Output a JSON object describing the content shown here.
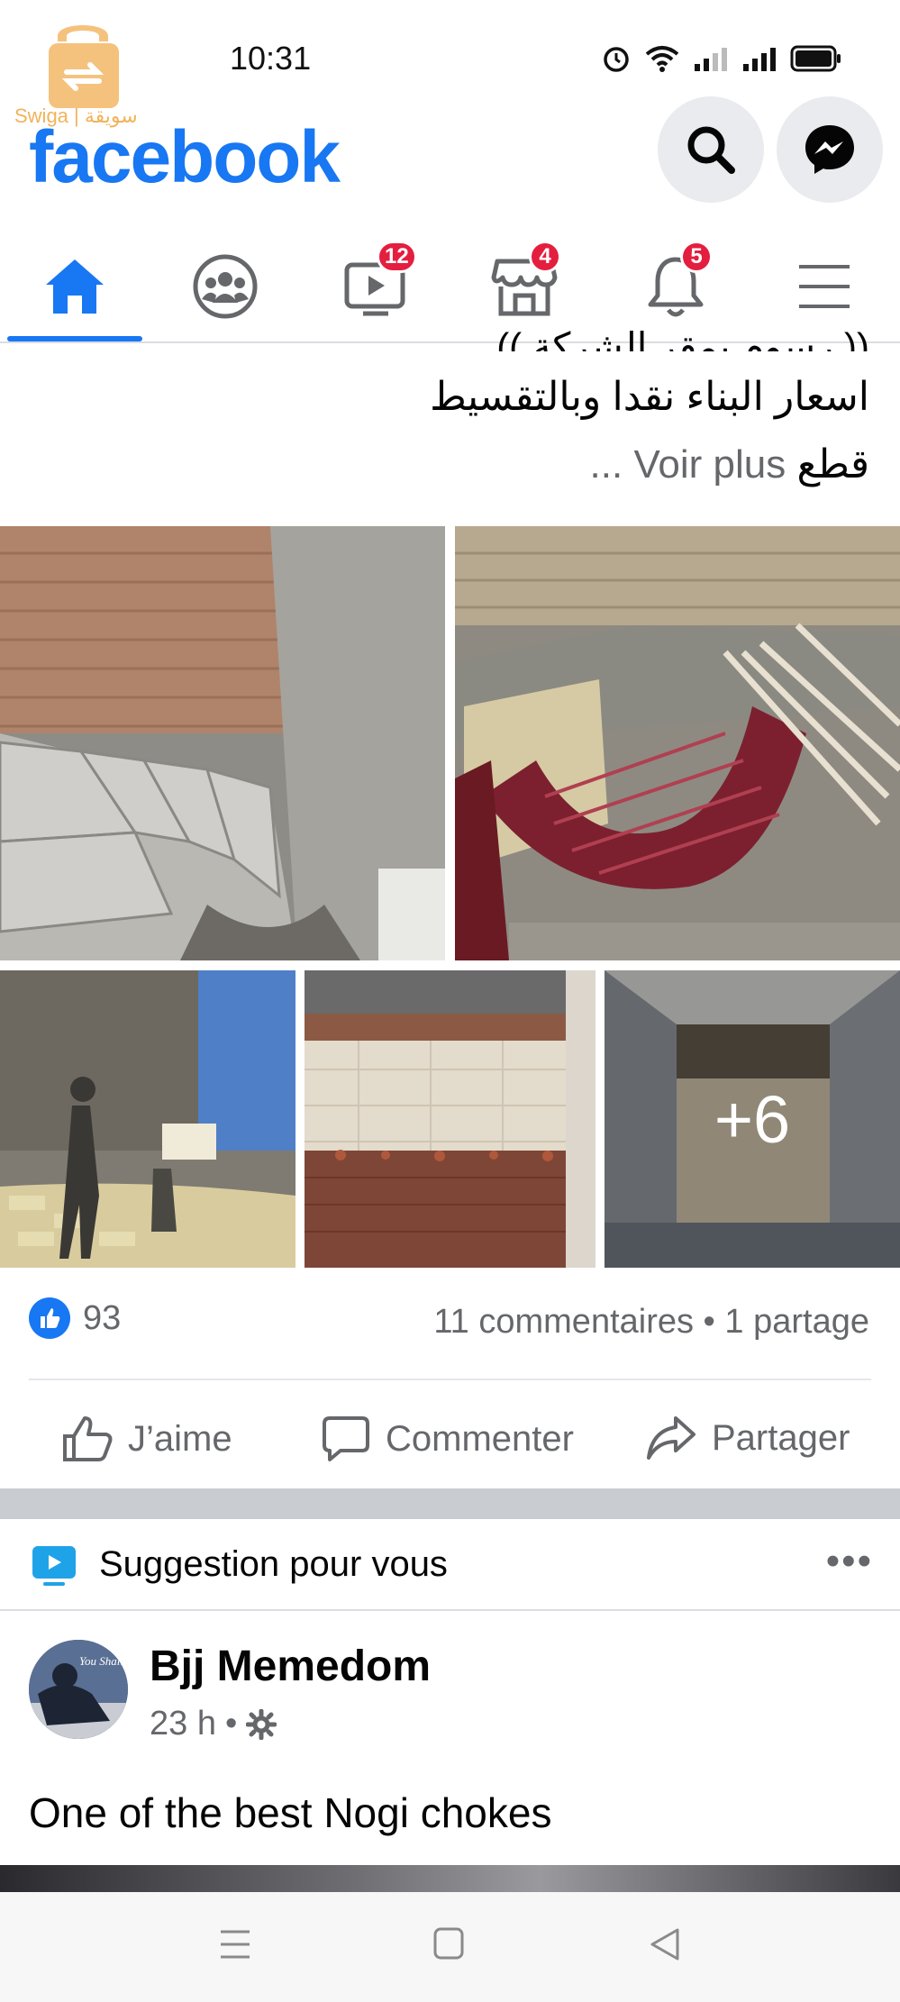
{
  "status_bar": {
    "time": "10:31"
  },
  "watermark": {
    "text": "Swiga | سويقة"
  },
  "header": {
    "logo": "facebook",
    "search_icon": "search-icon",
    "messenger_icon": "messenger-icon"
  },
  "nav": {
    "items": [
      {
        "name": "home",
        "icon": "home-icon",
        "badge": ""
      },
      {
        "name": "groups",
        "icon": "groups-icon",
        "badge": ""
      },
      {
        "name": "watch",
        "icon": "video-icon",
        "badge": "12"
      },
      {
        "name": "marketplace",
        "icon": "marketplace-icon",
        "badge": "4"
      },
      {
        "name": "notifications",
        "icon": "bell-icon",
        "badge": "5"
      },
      {
        "name": "menu",
        "icon": "menu-icon",
        "badge": ""
      }
    ],
    "active_color": "#1877F2",
    "badge_color": "#E41E3F"
  },
  "post1": {
    "line0": "(( رسوم بمقر الشركة ))",
    "line1": "اسعار البناء نقدا وبالتقسيط",
    "line2_text": "قطع",
    "see_more": "Voir plus ...",
    "extra_photos": "+6",
    "like_count": "93",
    "comments_shares": "11 commentaires • 1 partage",
    "actions": {
      "like": "J’aime",
      "comment": "Commenter",
      "share": "Partager"
    }
  },
  "suggestion": {
    "label": "Suggestion pour vous",
    "more": "•••"
  },
  "post2": {
    "author": "Bjj Memedom",
    "time": "23 h",
    "meta_separator": "•",
    "text": "One of the best Nogi chokes",
    "avatar_text": "You Shall"
  },
  "system_nav": {
    "items": [
      "menu-icon",
      "home-square-icon",
      "back-icon"
    ]
  }
}
